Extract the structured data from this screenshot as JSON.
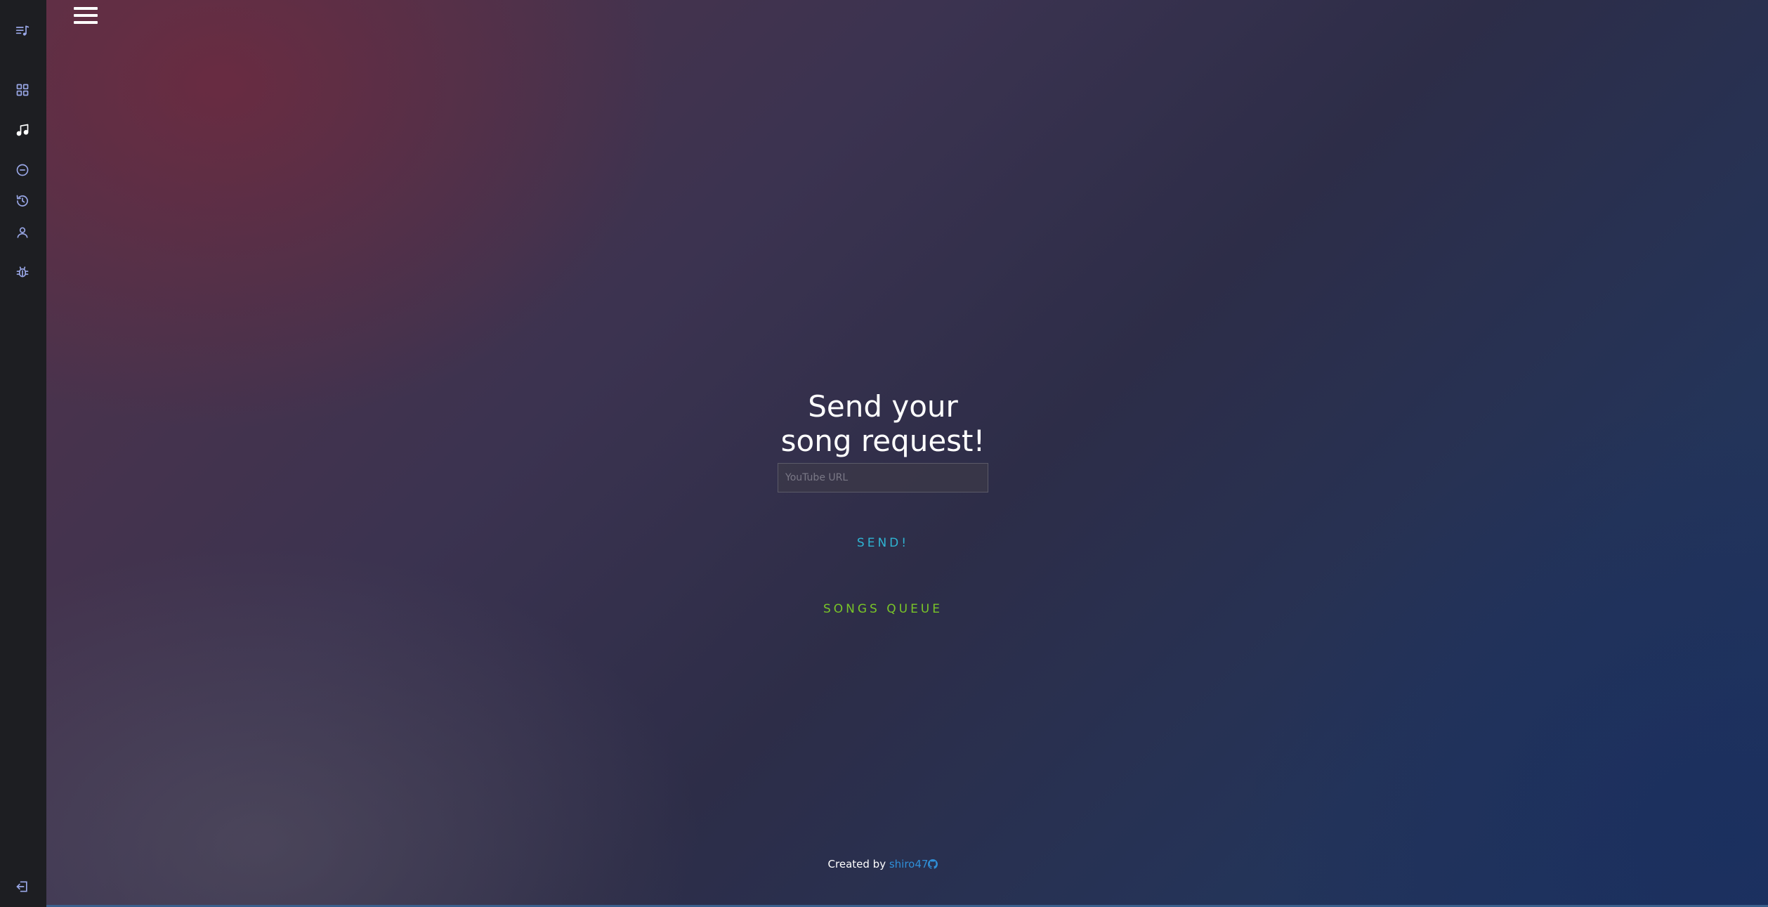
{
  "sidebar": {
    "items": [
      {
        "icon": "playlist-music-icon",
        "active": false
      },
      {
        "icon": "dashboard-grid-icon",
        "active": false
      },
      {
        "icon": "music-note-icon",
        "active": true
      },
      {
        "icon": "minus-circle-icon",
        "active": false
      },
      {
        "icon": "history-icon",
        "active": false
      },
      {
        "icon": "user-icon",
        "active": false
      },
      {
        "icon": "bug-icon",
        "active": false
      }
    ],
    "logout_icon": "logout-icon",
    "icon_color": "#9aa8e8",
    "active_icon_color": "#ffffff",
    "background": "#1d1e22"
  },
  "header": {
    "menu_icon": "hamburger-menu-icon"
  },
  "main": {
    "title_line1": "Send your",
    "title_line2": "song request!",
    "url_placeholder": "YouTube URL",
    "url_value": "",
    "send_label": "SEND!",
    "queue_label": "SONGS QUEUE"
  },
  "footer": {
    "created_by": "Created by",
    "author": "shiro47",
    "author_icon": "github-icon"
  },
  "colors": {
    "send": "#2fb4d2",
    "queue": "#79c528",
    "link": "#2f8fd8"
  }
}
